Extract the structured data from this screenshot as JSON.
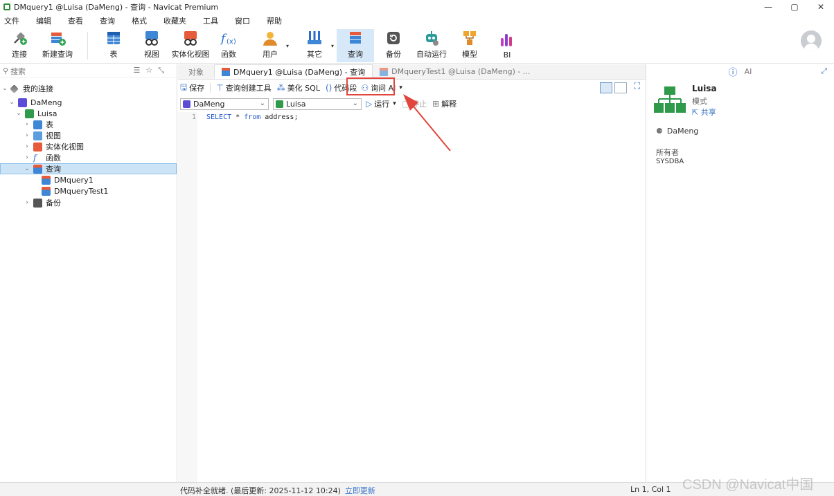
{
  "window": {
    "title": "DMquery1 @Luisa (DaMeng) - 查询 - Navicat Premium",
    "controls": [
      "✕",
      "▢",
      "—"
    ]
  },
  "menu": [
    "文件",
    "编辑",
    "查看",
    "查询",
    "格式",
    "收藏夹",
    "工具",
    "窗口",
    "帮助"
  ],
  "toolbar": {
    "connect": "连接",
    "new_query": "新建查询",
    "table": "表",
    "view": "视图",
    "mat_view": "实体化视图",
    "function": "函数",
    "user": "用户",
    "other": "其它",
    "query": "查询",
    "backup": "备份",
    "automation": "自动运行",
    "model": "模型",
    "bi": "BI"
  },
  "navigator": {
    "search_placeholder": "搜索",
    "tree": {
      "root": "我的连接",
      "connection": "DaMeng",
      "schema": "Luisa",
      "items": [
        "表",
        "视图",
        "实体化视图",
        "函数",
        "查询",
        "备份"
      ],
      "queries": [
        "DMquery1",
        "DMqueryTest1"
      ]
    }
  },
  "tabs": {
    "objects": "对象",
    "query1": "DMquery1 @Luisa (DaMeng) - 查询",
    "query2": "DMqueryTest1 @Luisa (DaMeng) - ..."
  },
  "query_toolbar": {
    "save": "保存",
    "builder": "查询创建工具",
    "beautify": "美化 SQL",
    "snippet": "代码段",
    "ask_ai": "询问 AI",
    "ask_ai_arrow": "▾"
  },
  "selectors": {
    "connection": "DaMeng",
    "schema": "Luisa",
    "run": "运行",
    "run_arrow": "▾",
    "stop": "停止",
    "explain": "解释"
  },
  "editor": {
    "line_number": "1",
    "sql_select": "SELECT",
    "sql_middle": " * ",
    "sql_from": "from",
    "sql_rest": " address;"
  },
  "info_panel": {
    "ai_label": "AI",
    "name": "Luisa",
    "type": "模式",
    "share": "共享",
    "connection": "DaMeng",
    "owner_label": "所有者",
    "owner": "SYSDBA"
  },
  "status": {
    "message": "代码补全就绪. (最后更新: 2025-11-12 10:24)",
    "update_link": "立即更新",
    "cursor": "Ln 1, Col 1"
  },
  "watermark": "CSDN @Navicat中国",
  "colors": {
    "accent": "#3a74c9",
    "highlight_box": "#e2453c",
    "selected_row": "#cde4f7"
  }
}
